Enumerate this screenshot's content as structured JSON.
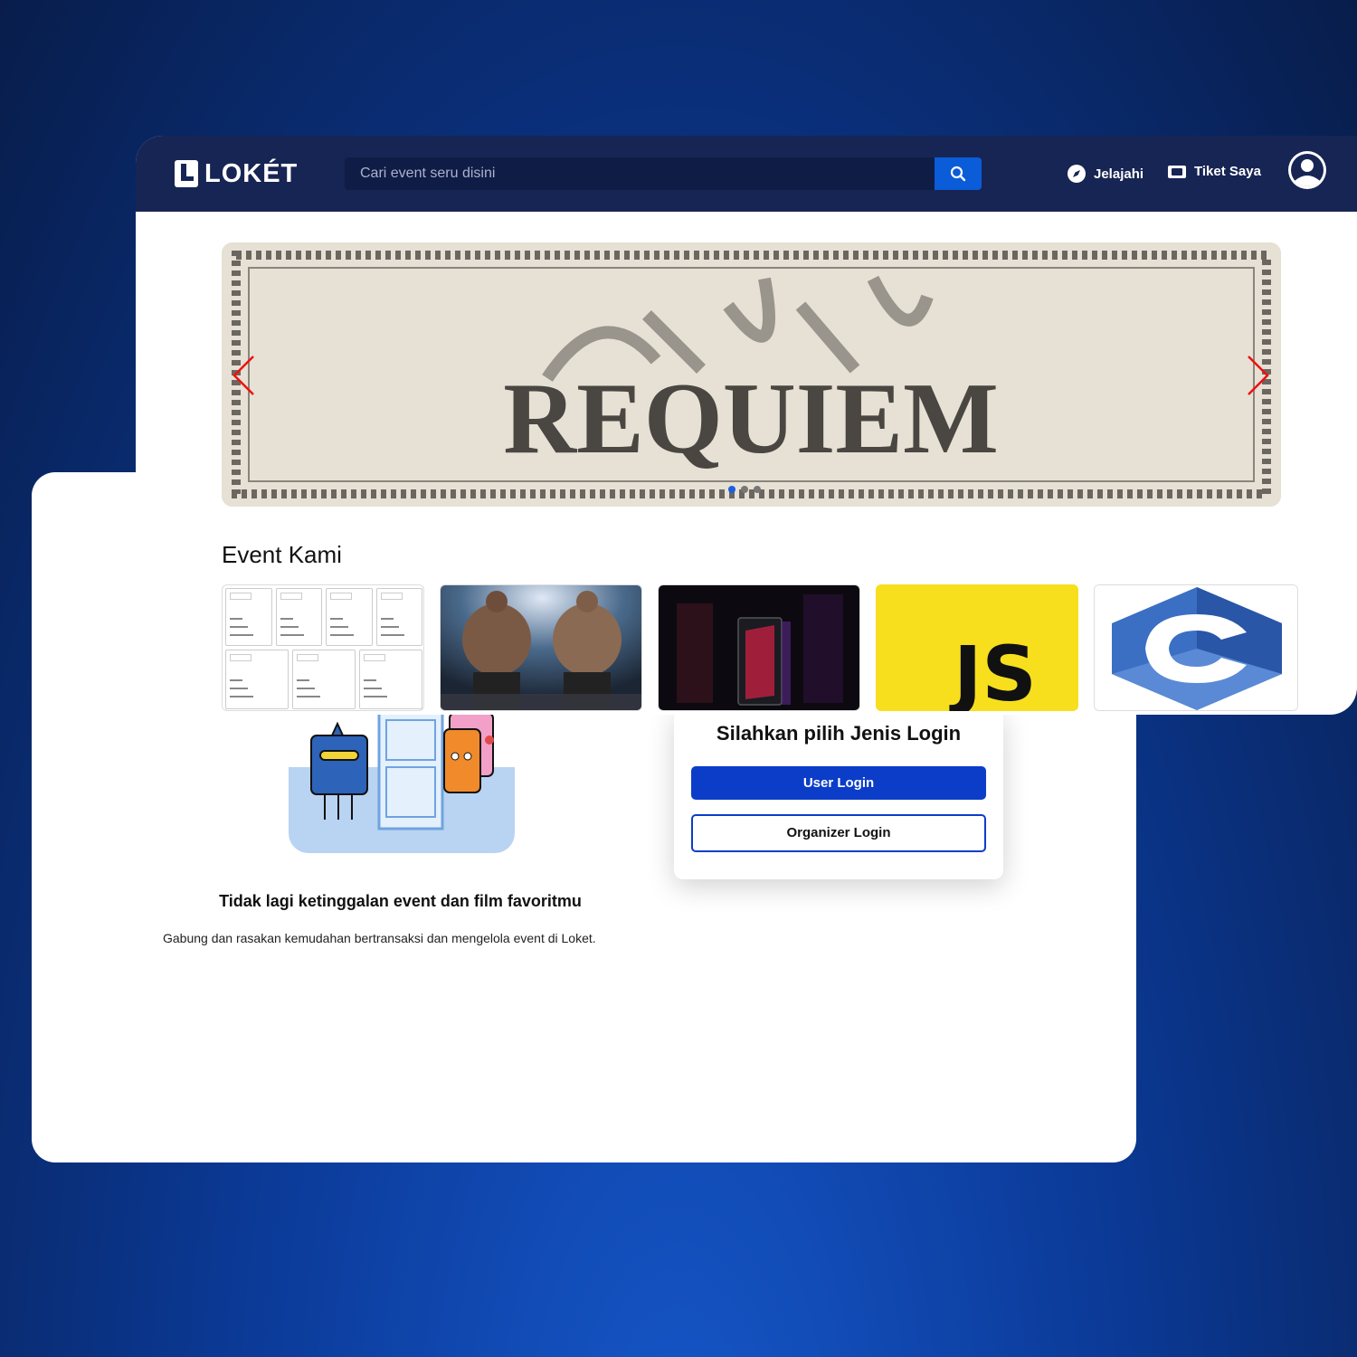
{
  "navbar": {
    "brand": "LOKÉT",
    "search_placeholder": "Cari event seru disini",
    "links": [
      {
        "label": "Jelajahi",
        "icon": "compass-icon"
      },
      {
        "label": "Tiket Saya",
        "icon": "ticket-icon"
      }
    ]
  },
  "banner": {
    "image_text": "REQUIEM",
    "slides_count": 3,
    "active_slide": 1
  },
  "events_section": {
    "title": "Event Kami",
    "cards": [
      {
        "image": "event-list-screenshot"
      },
      {
        "image": "fighters-image"
      },
      {
        "image": "pc-tower-image"
      },
      {
        "image": "js-logo",
        "text": "JS"
      },
      {
        "image": "c-language-logo"
      }
    ]
  },
  "login_page": {
    "card_title": "Silahkan pilih Jenis Login",
    "user_login_label": "User Login",
    "organizer_login_label": "Organizer Login",
    "headline": "Tidak lagi ketinggalan event dan film favoritmu",
    "subtext": "Gabung dan rasakan kemudahan bertransaksi dan mengelola event di Loket."
  },
  "colors": {
    "navbar": "#172554",
    "accent_blue": "#0b3dc9",
    "search_button": "#0b5cd8",
    "js_yellow": "#f7df1e"
  }
}
